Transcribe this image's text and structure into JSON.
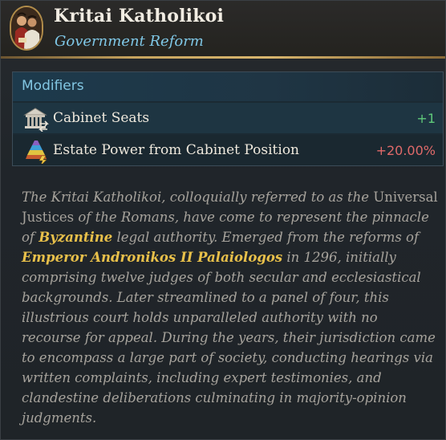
{
  "header": {
    "title": "Kritai Katholikoi",
    "subtitle": "Government Reform",
    "portrait_icon": "judges-portrait-icon"
  },
  "modifiers": {
    "heading": "Modifiers",
    "rows": [
      {
        "icon": "cabinet-building-icon",
        "label": "Cabinet Seats",
        "value": "+1",
        "value_color": "#5fc97a"
      },
      {
        "icon": "estate-pyramid-icon",
        "label": "Estate Power from Cabinet Position",
        "value": "+20.00%",
        "value_color": "#e06a6a"
      }
    ]
  },
  "description": {
    "p1": "The Kritai Katholikoi, colloquially referred to as the ",
    "p2": "Universal Justices",
    "p3": " of the Romans, have come to represent the pinnacle of ",
    "highlight1": "Byzantine",
    "p4": " legal authority. Emerged from the reforms of ",
    "highlight2": "Emperor Andronikos II Palaiologos",
    "p5": " in 1296, initially comprising twelve judges of both secular and ecclesiastical backgrounds. Later streamlined to a panel of four, this illustrious court holds unparalleled authority with no recourse for appeal. During the years, their jurisdiction came to encompass a large part of society, conducting hearings via written complaints, including expert testimonies, and clandestine deliberations culminating in majority-opinion judgments."
  },
  "colors": {
    "title": "#f1ece2",
    "subtitle": "#7fc7e6",
    "gold": "#c7a45e",
    "highlight": "#e8c04a",
    "description": "#a7a39c"
  }
}
